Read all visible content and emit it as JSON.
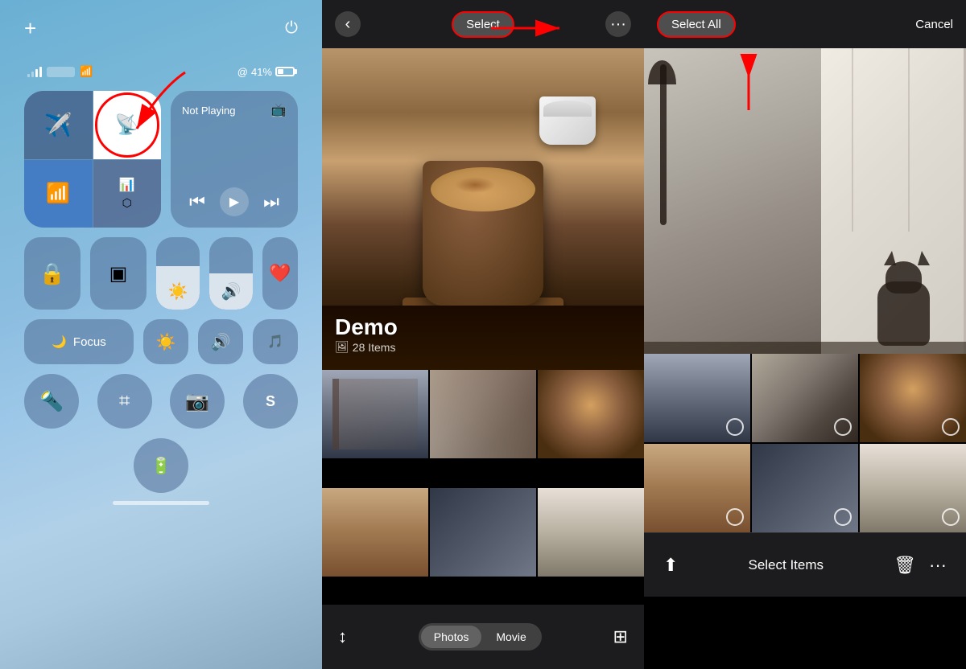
{
  "panel1": {
    "status": {
      "battery_percent": "41%",
      "wifi_icon": "wifi",
      "battery_icon": "battery"
    },
    "top_buttons": {
      "plus_label": "+",
      "power_label": "⏻"
    },
    "connectivity": {
      "airplane_label": "✈",
      "airdrop_label": "📡",
      "wifi_label": "wifi",
      "bluetooth_label": "bt"
    },
    "now_playing": {
      "label": "Not Playing",
      "rewind": "⏮",
      "play": "▶",
      "forward": "⏭"
    },
    "focus": {
      "moon_label": "🌙",
      "focus_text": "Focus"
    },
    "tools": {
      "flashlight": "🔦",
      "calculator": "⌗",
      "camera": "📷",
      "shazam": "S"
    }
  },
  "panel2": {
    "header": {
      "back_label": "‹",
      "select_label": "Select",
      "more_label": "···"
    },
    "album": {
      "title": "Demo",
      "count": "28 Items"
    },
    "bottom": {
      "sort_label": "↕",
      "tab_photos": "Photos",
      "tab_movie": "Movie",
      "grid_label": "⊞"
    }
  },
  "panel3": {
    "header": {
      "select_all_label": "Select All",
      "cancel_label": "Cancel"
    },
    "bottom": {
      "share_label": "⬆",
      "select_items_label": "Select Items",
      "delete_label": "🗑",
      "more_label": "···"
    }
  }
}
